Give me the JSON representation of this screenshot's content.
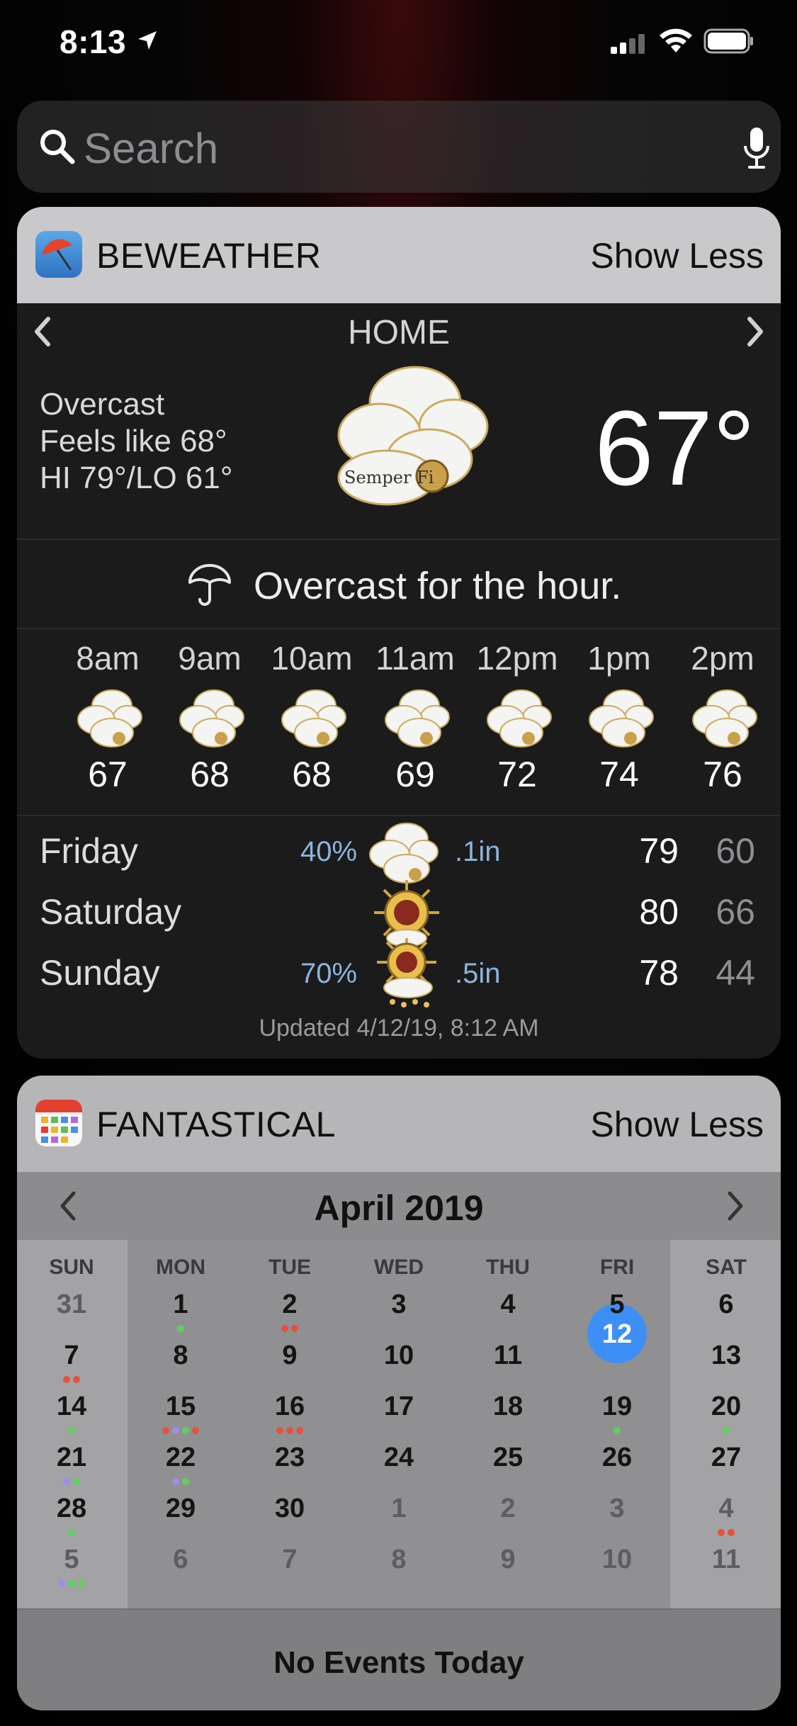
{
  "status_bar": {
    "time": "8:13"
  },
  "search": {
    "placeholder": "Search"
  },
  "beweather": {
    "app_name": "BEWEATHER",
    "toggle_label": "Show Less",
    "location": "HOME",
    "condition": "Overcast",
    "feels_like": "Feels like 68°",
    "hi_lo": "HI 79°/LO 61°",
    "temperature": "67°",
    "icon_text": "Semper Fi",
    "summary": "Overcast for the hour.",
    "hourly": [
      {
        "time": "8am",
        "temp": "67"
      },
      {
        "time": "9am",
        "temp": "68"
      },
      {
        "time": "10am",
        "temp": "68"
      },
      {
        "time": "11am",
        "temp": "69"
      },
      {
        "time": "12pm",
        "temp": "72"
      },
      {
        "time": "1pm",
        "temp": "74"
      },
      {
        "time": "2pm",
        "temp": "76"
      }
    ],
    "daily": [
      {
        "day": "Friday",
        "chance": "40%",
        "precip": ".1in",
        "hi": "79",
        "lo": "60"
      },
      {
        "day": "Saturday",
        "chance": "",
        "precip": "",
        "hi": "80",
        "lo": "66"
      },
      {
        "day": "Sunday",
        "chance": "70%",
        "precip": ".5in",
        "hi": "78",
        "lo": "44"
      }
    ],
    "updated": "Updated 4/12/19, 8:12 AM"
  },
  "fantastical": {
    "app_name": "FANTASTICAL",
    "toggle_label": "Show Less",
    "month": "April 2019",
    "weekdays": [
      "SUN",
      "MON",
      "TUE",
      "WED",
      "THU",
      "FRI",
      "SAT"
    ],
    "weeks": [
      [
        "31",
        "1",
        "2",
        "3",
        "4",
        "5",
        "6"
      ],
      [
        "7",
        "8",
        "9",
        "10",
        "11",
        "12",
        "13"
      ],
      [
        "14",
        "15",
        "16",
        "17",
        "18",
        "19",
        "20"
      ],
      [
        "21",
        "22",
        "23",
        "24",
        "25",
        "26",
        "27"
      ],
      [
        "28",
        "29",
        "30",
        "1",
        "2",
        "3",
        "4"
      ],
      [
        "5",
        "6",
        "7",
        "8",
        "9",
        "10",
        "11"
      ]
    ],
    "today": "12",
    "footer": "No Events Today",
    "colors": {
      "green": "#5ed05e",
      "red": "#e6503c",
      "purple": "#a08cf0",
      "today": "#3d8ff5"
    }
  }
}
